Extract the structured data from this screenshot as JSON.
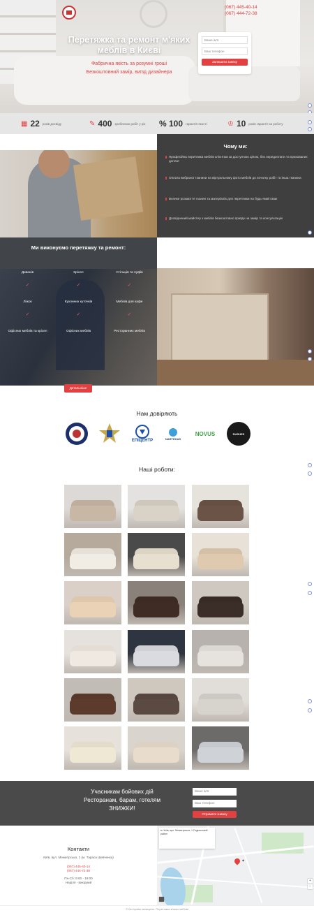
{
  "header": {
    "phones": [
      "(067) 445-40-14",
      "(067) 444-72-38"
    ],
    "title": "Перетяжка та ремонт м'яких меблів в Києві",
    "red_lines": [
      "Фабрична якість за розумні гроші",
      "Безкоштовний замір, виїзд дизайнера"
    ],
    "form": {
      "name_placeholder": "Ваше ім'я",
      "phone_placeholder": "Ваш телефон",
      "submit_label": "Залишити заявку"
    }
  },
  "stats": [
    {
      "icon": "calendar-icon",
      "number": "22",
      "label": "років досвіду"
    },
    {
      "icon": "wrench-icon",
      "number": "400",
      "label": "зроблених робіт у рік"
    },
    {
      "icon": "percent-icon",
      "number": "% 100",
      "label": "гарантія якості"
    },
    {
      "icon": "trophy-icon",
      "number": "10",
      "label": "років гарантії на роботу"
    }
  ],
  "why": {
    "title": "Чому ми:",
    "items": [
      "Професійна перетяжка меблів клієнтам за доступною ціною, без передоплати та прихованих доплат",
      "Оплата вибраної тканини на віртуальному фото меблів до початку робіт та інша тканина",
      "Велике розмаїття тканин та матеріалів для перетяжки на будь-який смак",
      "Досвідчений майстер з меблів безкоштовно приїде на замір та консультацію"
    ]
  },
  "services": {
    "title": "Ми виконуємо перетяжку та ремонт:",
    "items": [
      "Диванів",
      "Крісел",
      "Стільців та пуфів",
      "Ліжок",
      "Кухонних куточків",
      "Меблів для кафе",
      "Офісних меблів та крісел",
      "Офісних меблів",
      "Ресторанних меблів"
    ],
    "button_label": "Детальніше"
  },
  "trust": {
    "title": "Нам довіряють",
    "logos": [
      "ЕПІЦЕНТР",
      "NARTEKAS",
      "NOVUS",
      "DUSHES"
    ]
  },
  "works": {
    "title": "Наші роботи:"
  },
  "promo": {
    "lines": [
      "Учасникам бойових дій",
      "Ресторанам, барам, готелям",
      "ЗНИЖКИ!"
    ],
    "name_placeholder": "Ваше ім'я",
    "phone_placeholder": "Ваш телефон",
    "submit_label": "Отримати знижку"
  },
  "contacts": {
    "title": "Контакти",
    "address": "Київ, вул. Межигірська, 1 (м. Тараса Шевченка)",
    "phones": [
      "(067) 445-40-14",
      "(067) 444-72-38"
    ],
    "hours": [
      "Пн-Сб: 9:00 - 19:00",
      "Неділя - вихідний"
    ]
  },
  "map": {
    "card_text": "м. Київ, вул. Межигірська, 1 Подільський район"
  },
  "footer": {
    "text": "© Всі права захищено. Перетяжка м'яких меблів"
  }
}
